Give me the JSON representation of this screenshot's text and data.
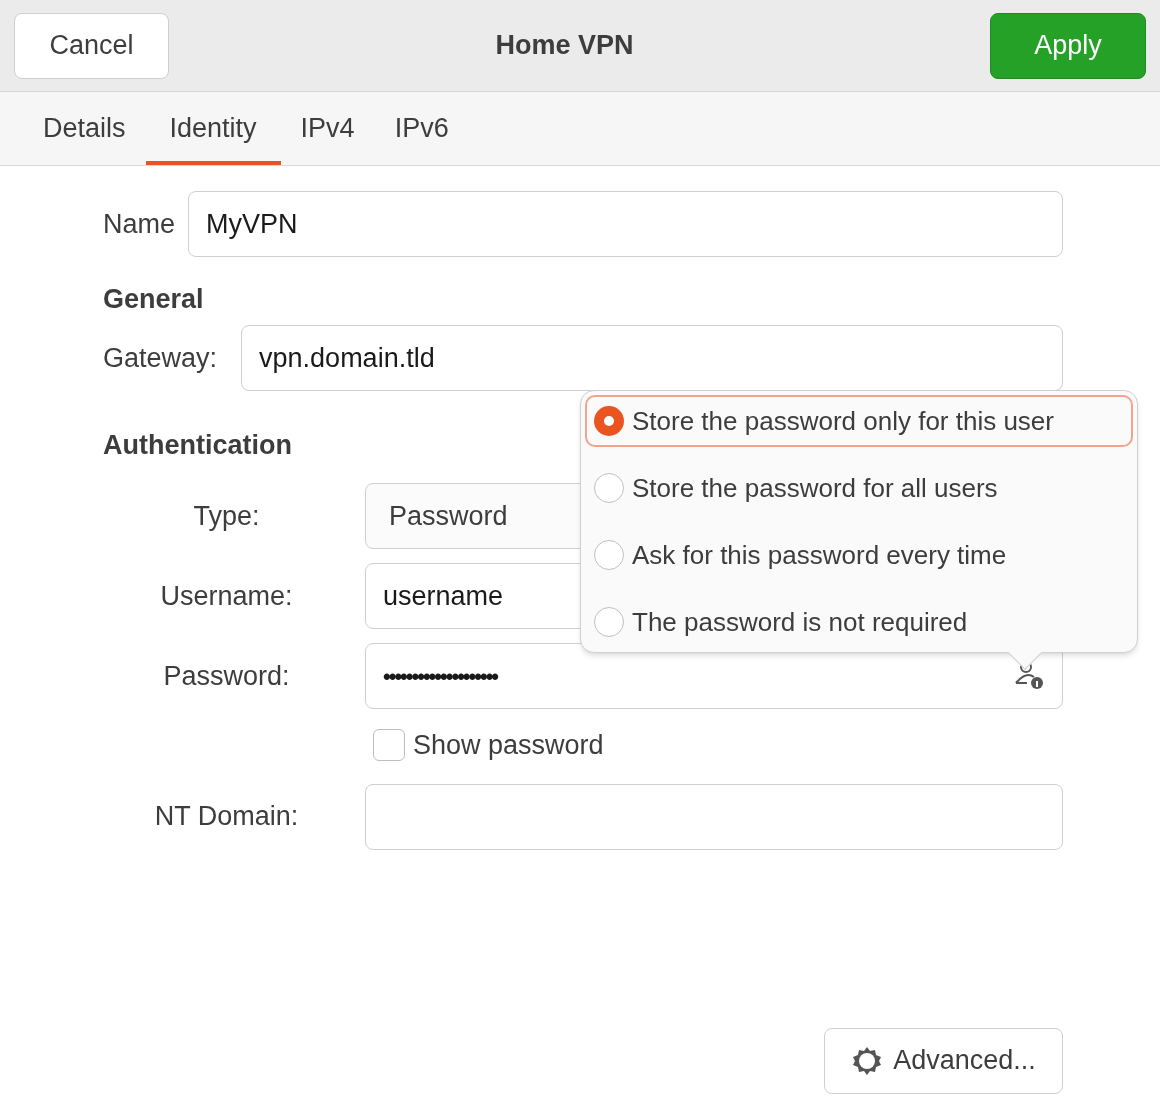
{
  "header": {
    "title": "Home VPN",
    "cancel": "Cancel",
    "apply": "Apply"
  },
  "tabs": [
    {
      "label": "Details",
      "selected": false
    },
    {
      "label": "Identity",
      "selected": true
    },
    {
      "label": "IPv4",
      "selected": false
    },
    {
      "label": "IPv6",
      "selected": false
    }
  ],
  "name": {
    "label": "Name",
    "value": "MyVPN"
  },
  "general": {
    "heading": "General",
    "gateway_label": "Gateway:",
    "gateway": "vpn.domain.tld"
  },
  "authentication": {
    "heading": "Authentication",
    "type_label": "Type:",
    "type": "Password",
    "username_label": "Username:",
    "username": "username",
    "password_label": "Password:",
    "password": "••••••••••••••••••••",
    "show_password": {
      "label": "Show password",
      "checked": false
    },
    "nt_domain_label": "NT Domain:"
  },
  "password_storage_menu": [
    {
      "label": "Store the password only for this user",
      "selected": true
    },
    {
      "label": "Store the password for all users",
      "selected": false
    },
    {
      "label": "Ask for this password every time",
      "selected": false
    },
    {
      "label": "The password is not required",
      "selected": false
    }
  ],
  "advanced": "Advanced..."
}
